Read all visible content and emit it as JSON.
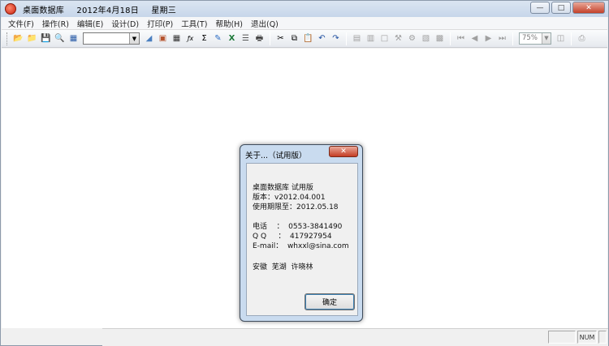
{
  "window": {
    "app_name": "桌面数据库",
    "date": "2012年4月18日",
    "weekday": "星期三",
    "minimize_icon": "minimize-icon",
    "maximize_icon": "maximize-icon",
    "close_icon": "close-icon"
  },
  "menu": [
    {
      "label": "文件(F)"
    },
    {
      "label": "操作(R)"
    },
    {
      "label": "编辑(E)"
    },
    {
      "label": "设计(D)"
    },
    {
      "label": "打印(P)"
    },
    {
      "label": "工具(T)"
    },
    {
      "label": "帮助(H)"
    },
    {
      "label": "退出(Q)"
    }
  ],
  "toolbar": {
    "font_value": "",
    "zoom_value": "75%",
    "glyphs": {
      "open": "📂",
      "folder": "📁",
      "save": "💾",
      "find": "🔍",
      "table": "▦",
      "cut": "✂",
      "copy": "⧉",
      "paste": "📋",
      "undo": "↶",
      "redo": "↷",
      "first": "⏮",
      "prev": "◀",
      "next": "▶",
      "last": "⏭",
      "sum": "Σ",
      "fx": "ƒx",
      "print": "🖶",
      "excel": "X"
    }
  },
  "dialog": {
    "title": "关于...（试用版）",
    "close_label": "✕",
    "line1": "桌面数据库 试用版",
    "line2": "版本：v2012.04.001",
    "line3": "使用期限至：2012.05.18",
    "phone_line": "电话    ：  0553-3841490",
    "qq_line": "Q Q     ：  417927954",
    "email_line": "E-mail：  whxxl@sina.com",
    "location": "安徽  芜湖  许晓林",
    "ok_label": "确定"
  },
  "status": {
    "pane1": "",
    "pane2": "NUM",
    "pane3": ""
  }
}
